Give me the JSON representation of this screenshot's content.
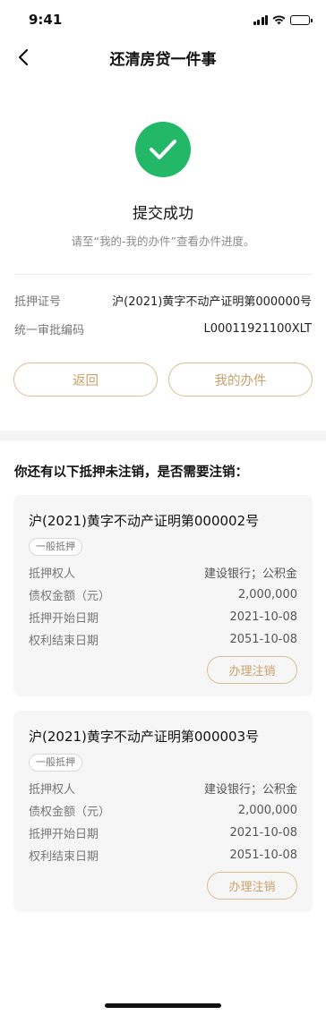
{
  "status_bar": {
    "time": "9:41"
  },
  "nav": {
    "title": "还清房贷一件事"
  },
  "success": {
    "title": "提交成功",
    "subtitle": "请至“我的-我的办件”查看办件进度。",
    "icon_color": "#22b868"
  },
  "info": [
    {
      "label": "抵押证号",
      "value": "沪(2021)黄字不动产证明第000000号"
    },
    {
      "label": "统一审批编码",
      "value": "L00011921100XLT"
    }
  ],
  "buttons": {
    "back": "返回",
    "my_cases": "我的办件"
  },
  "section_title": "你还有以下抵押未注销，是否需要注销：",
  "cards": [
    {
      "title": "沪(2021)黄字不动产证明第000002号",
      "tag": "一般抵押",
      "rows": [
        {
          "label": "抵押权人",
          "value": "建设银行；公积金"
        },
        {
          "label": "债权金额（元）",
          "value": "2,000,000"
        },
        {
          "label": "抵押开始日期",
          "value": "2021-10-08"
        },
        {
          "label": "权利结束日期",
          "value": "2051-10-08"
        }
      ],
      "action": "办理注销"
    },
    {
      "title": "沪(2021)黄字不动产证明第000003号",
      "tag": "一般抵押",
      "rows": [
        {
          "label": "抵押权人",
          "value": "建设银行；公积金"
        },
        {
          "label": "债权金额（元）",
          "value": "2,000,000"
        },
        {
          "label": "抵押开始日期",
          "value": "2021-10-08"
        },
        {
          "label": "权利结束日期",
          "value": "2051-10-08"
        }
      ],
      "action": "办理注销"
    }
  ],
  "colors": {
    "accent": "#c9a06a",
    "accent_border": "#d9bf93",
    "success": "#22b868",
    "card_bg": "#f6f6f6"
  }
}
